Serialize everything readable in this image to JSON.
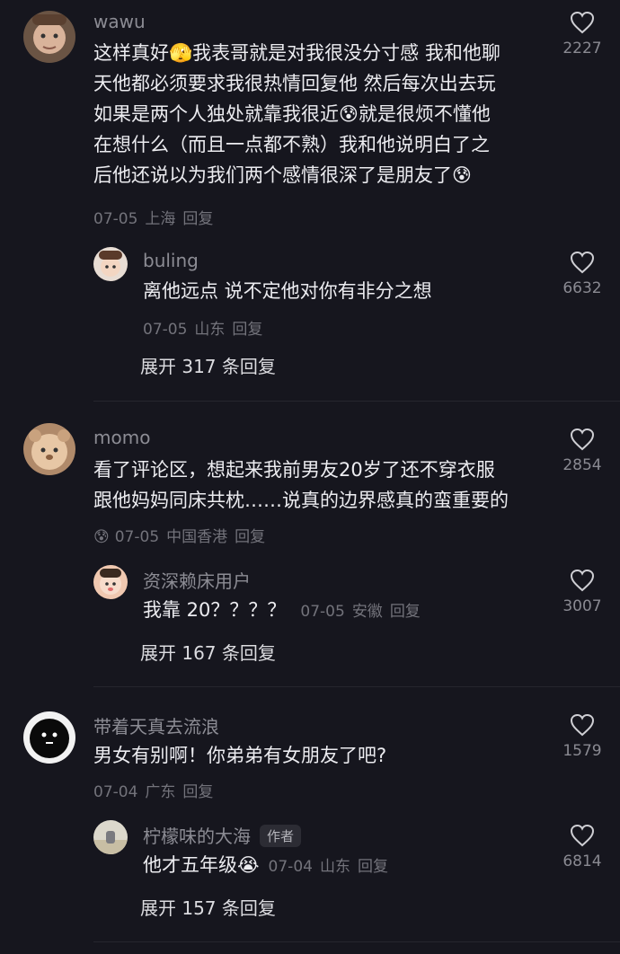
{
  "comments": [
    {
      "user": "wawu",
      "text": "这样真好🫣我表哥就是对我很没分寸感 我和他聊\n天他都必须要求我很热情回复他 然后每次出去玩\n如果是两个人独处就靠我很近😰就是很烦不懂他\n在想什么（而且一点都不熟）我和他说明白了之\n后他还说以为我们两个感情很深了是朋友了😰",
      "date": "07-05",
      "location": "上海",
      "reply_label": "回复",
      "likes": "2227",
      "reply": {
        "user": "buling",
        "text": "离他远点 说不定他对你有非分之想",
        "date": "07-05",
        "location": "山东",
        "reply_label": "回复",
        "likes": "6632"
      },
      "expand": "展开 317 条回复"
    },
    {
      "user": "momo",
      "text": "看了评论区，想起来我前男友20岁了还不穿衣服\n跟他妈妈同床共枕……说真的边界感真的蛮重要的",
      "lead_emoji": "😰",
      "date": "07-05",
      "location": "中国香港",
      "reply_label": "回复",
      "likes": "2854",
      "reply": {
        "user": "资深赖床用户",
        "text": "我靠 20？？？？",
        "date": "07-05",
        "location": "安徽",
        "reply_label": "回复",
        "likes": "3007"
      },
      "expand": "展开 167 条回复"
    },
    {
      "user": "带着天真去流浪",
      "text": "男女有别啊！你弟弟有女朋友了吧?",
      "date": "07-04",
      "location": "广东",
      "reply_label": "回复",
      "likes": "1579",
      "reply": {
        "user": "柠檬味的大海",
        "badge": "作者",
        "text": "他才五年级😭",
        "date": "07-04",
        "location": "山东",
        "reply_label": "回复",
        "likes": "6814"
      },
      "expand": "展开 157 条回复"
    }
  ],
  "icons": {
    "like": "heart-outline-icon"
  },
  "colors": {
    "background": "#16161e",
    "secondary_text": "#8c8c94",
    "meta_text": "#73737b"
  }
}
